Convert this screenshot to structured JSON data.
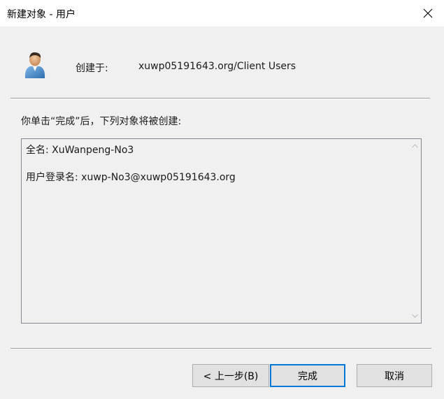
{
  "window": {
    "title": "新建对象 - 用户",
    "close_icon": "close-icon"
  },
  "header": {
    "icon": "user-icon",
    "created_in_label": "创建于:",
    "created_in_value": "xuwp05191643.org/Client Users"
  },
  "intro_text": "你单击“完成”后，下列对象将被创建:",
  "summary": {
    "lines": [
      "全名: XuWanpeng-No3",
      "用户登录名: xuwp-No3@xuwp05191643.org"
    ]
  },
  "buttons": {
    "back": "< 上一步(B)",
    "finish": "完成",
    "cancel": "取消"
  },
  "colors": {
    "accent": "#0078d7",
    "dialog_bg": "#f0f0f0",
    "title_bg": "#ffffff"
  }
}
